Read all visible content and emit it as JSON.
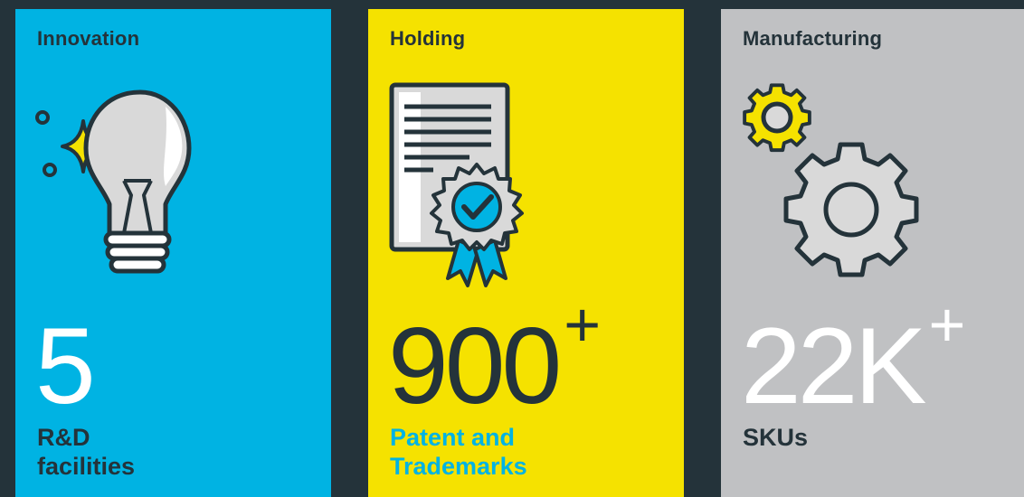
{
  "colors": {
    "background": "#24333a",
    "innovation": "#00b3e3",
    "holding": "#f5e200",
    "manufacturing": "#c0c1c3",
    "dark_text": "#24333a",
    "accent_blue": "#00b3e3"
  },
  "cards": [
    {
      "title": "Innovation",
      "icon": "lightbulb-icon",
      "number": "5",
      "suffix": "",
      "caption": "R&D\nfacilities"
    },
    {
      "title": "Holding",
      "icon": "certificate-icon",
      "number": "900",
      "suffix": "+",
      "caption": "Patent and\nTrademarks"
    },
    {
      "title": "Manufacturing",
      "icon": "gears-icon",
      "number": "22K",
      "suffix": "+",
      "caption": "SKUs"
    }
  ]
}
